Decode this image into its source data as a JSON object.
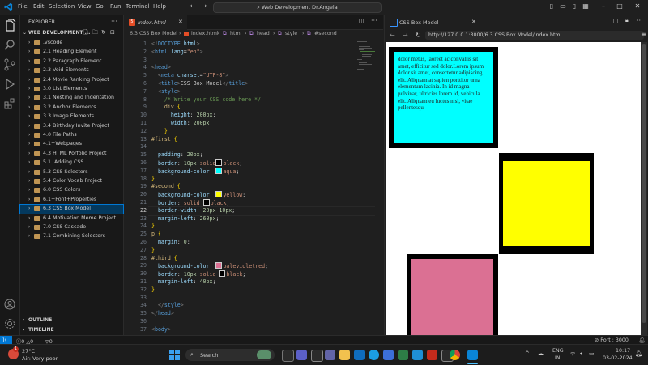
{
  "menu": [
    "File",
    "Edit",
    "Selection",
    "View",
    "Go",
    "Run",
    "Terminal",
    "Help"
  ],
  "search": {
    "text": "Web Development Dr.Angela"
  },
  "sidebar": {
    "title": "EXPLORER",
    "root": "WEB DEVELOPMENT ...",
    "items": [
      {
        "label": ".vscode"
      },
      {
        "label": "2.1 Heading Element"
      },
      {
        "label": "2.2 Paragraph Element"
      },
      {
        "label": "2.3 Void Elements"
      },
      {
        "label": "2.4 Movie Ranking Project"
      },
      {
        "label": "3.0 List Elements"
      },
      {
        "label": "3.1 Nesting and Indentation"
      },
      {
        "label": "3.2 Anchor Elements"
      },
      {
        "label": "3.3 Image Elements"
      },
      {
        "label": "3.4 Birthday Invite Project"
      },
      {
        "label": "4.0 File Paths"
      },
      {
        "label": "4.1+Webpages"
      },
      {
        "label": "4.3 HTML Porfolio Project"
      },
      {
        "label": "5.1. Adding CSS"
      },
      {
        "label": "5.3 CSS Selectors"
      },
      {
        "label": "5.4 Color Vocab Project"
      },
      {
        "label": "6.0 CSS Colors"
      },
      {
        "label": "6.1+Font+Properties"
      },
      {
        "label": "6.3 CSS Box Model"
      },
      {
        "label": "6.4 Motivation Meme Project"
      },
      {
        "label": "7.0 CSS Cascade"
      },
      {
        "label": "7.1 Combining Selectors"
      }
    ],
    "active_index": 18,
    "outline": "OUTLINE",
    "timeline": "TIMELINE"
  },
  "editor": {
    "tab": "index.html",
    "breadcrumb": {
      "folder": "6.3 CSS Box Model",
      "file": "index.html",
      "path": [
        "html",
        "head",
        "style",
        "#second"
      ]
    },
    "current_line": 22
  },
  "code_lines": [
    {
      "n": "1",
      "parts": [
        [
          "k-pun",
          "<!"
        ],
        [
          "k-tag",
          "DOCTYPE"
        ],
        [
          "k-attr",
          " html"
        ],
        [
          "k-pun",
          ">"
        ]
      ]
    },
    {
      "n": "2",
      "parts": [
        [
          "k-pun",
          "<"
        ],
        [
          "k-tag",
          "html"
        ],
        [
          "k-attr",
          " lang"
        ],
        [
          "",
          "="
        ],
        [
          "k-str",
          "\"en\""
        ],
        [
          "k-pun",
          ">"
        ]
      ]
    },
    {
      "n": "3",
      "parts": []
    },
    {
      "n": "4",
      "parts": [
        [
          "k-pun",
          "<"
        ],
        [
          "k-tag",
          "head"
        ],
        [
          "k-pun",
          ">"
        ]
      ]
    },
    {
      "n": "5",
      "parts": [
        [
          "",
          "  "
        ],
        [
          "k-pun",
          "<"
        ],
        [
          "k-tag",
          "meta"
        ],
        [
          "k-attr",
          " charset"
        ],
        [
          "",
          "="
        ],
        [
          "k-str",
          "\"UTF-8\""
        ],
        [
          "k-pun",
          ">"
        ]
      ]
    },
    {
      "n": "6",
      "parts": [
        [
          "",
          "  "
        ],
        [
          "k-pun",
          "<"
        ],
        [
          "k-tag",
          "title"
        ],
        [
          "k-pun",
          ">"
        ],
        [
          "",
          "CSS Box Model"
        ],
        [
          "k-pun",
          "</"
        ],
        [
          "k-tag",
          "title"
        ],
        [
          "k-pun",
          ">"
        ]
      ]
    },
    {
      "n": "7",
      "parts": [
        [
          "",
          "  "
        ],
        [
          "k-pun",
          "<"
        ],
        [
          "k-tag",
          "style"
        ],
        [
          "k-pun",
          ">"
        ]
      ]
    },
    {
      "n": "8",
      "parts": [
        [
          "",
          "    "
        ],
        [
          "k-cmt",
          "/* Write your CSS code here */"
        ]
      ]
    },
    {
      "n": "9",
      "parts": [
        [
          "",
          "    "
        ],
        [
          "k-sel",
          "div"
        ],
        [
          "k-brk",
          " {"
        ]
      ]
    },
    {
      "n": "10",
      "parts": [
        [
          "",
          "      "
        ],
        [
          "k-prop",
          "height"
        ],
        [
          "",
          ": "
        ],
        [
          "k-num",
          "200px"
        ],
        [
          "",
          ";"
        ]
      ]
    },
    {
      "n": "11",
      "parts": [
        [
          "",
          "      "
        ],
        [
          "k-prop",
          "width"
        ],
        [
          "",
          ": "
        ],
        [
          "k-num",
          "200px"
        ],
        [
          "",
          ";"
        ]
      ]
    },
    {
      "n": "12",
      "parts": [
        [
          "",
          "    "
        ],
        [
          "k-brk",
          "}"
        ]
      ]
    },
    {
      "n": "13",
      "parts": [
        [
          "k-sel",
          "#first"
        ],
        [
          "k-brk",
          " {"
        ]
      ]
    },
    {
      "n": "14",
      "parts": []
    },
    {
      "n": "15",
      "parts": [
        [
          "",
          "  "
        ],
        [
          "k-prop",
          "padding"
        ],
        [
          "",
          ": "
        ],
        [
          "k-num",
          "20px"
        ],
        [
          "",
          ";"
        ]
      ]
    },
    {
      "n": "16",
      "parts": [
        [
          "",
          "  "
        ],
        [
          "k-prop",
          "border"
        ],
        [
          "",
          ": "
        ],
        [
          "k-num",
          "10px"
        ],
        [
          "",
          " "
        ],
        [
          "k-val",
          "solid"
        ],
        [
          "sw:#000000",
          ""
        ],
        [
          "k-val",
          "black"
        ],
        [
          "",
          ";"
        ]
      ]
    },
    {
      "n": "17",
      "parts": [
        [
          "",
          "  "
        ],
        [
          "k-prop",
          "background-color"
        ],
        [
          "",
          ": "
        ],
        [
          "sw:#00ffff",
          ""
        ],
        [
          "k-val",
          "aqua"
        ],
        [
          "",
          ";"
        ]
      ]
    },
    {
      "n": "18",
      "parts": [
        [
          "k-brk",
          "}"
        ]
      ]
    },
    {
      "n": "19",
      "parts": [
        [
          "k-sel",
          "#second"
        ],
        [
          "k-brk",
          " {"
        ]
      ]
    },
    {
      "n": "20",
      "parts": [
        [
          "",
          "  "
        ],
        [
          "k-prop",
          "background-color"
        ],
        [
          "",
          ": "
        ],
        [
          "sw:#ffff00",
          ""
        ],
        [
          "k-val",
          "yellow"
        ],
        [
          "",
          ";"
        ]
      ]
    },
    {
      "n": "21",
      "parts": [
        [
          "",
          "  "
        ],
        [
          "k-prop",
          "border"
        ],
        [
          "",
          ": "
        ],
        [
          "k-val",
          "solid"
        ],
        [
          "",
          " "
        ],
        [
          "sw:#000000",
          ""
        ],
        [
          "k-val",
          "black"
        ],
        [
          "",
          ";"
        ]
      ]
    },
    {
      "n": "22",
      "parts": [
        [
          "",
          "  "
        ],
        [
          "k-prop",
          "border-width"
        ],
        [
          "",
          ": "
        ],
        [
          "k-num",
          "20px 10px"
        ],
        [
          "",
          ";"
        ]
      ]
    },
    {
      "n": "23",
      "parts": [
        [
          "",
          "  "
        ],
        [
          "k-prop",
          "margin-left"
        ],
        [
          "",
          ": "
        ],
        [
          "k-num",
          "260px"
        ],
        [
          "",
          ";"
        ]
      ]
    },
    {
      "n": "24",
      "parts": [
        [
          "k-brk",
          "}"
        ]
      ]
    },
    {
      "n": "25",
      "parts": [
        [
          "k-sel",
          "p"
        ],
        [
          "k-brk",
          " {"
        ]
      ]
    },
    {
      "n": "26",
      "parts": [
        [
          "",
          "  "
        ],
        [
          "k-prop",
          "margin"
        ],
        [
          "",
          ": "
        ],
        [
          "k-num",
          "0"
        ],
        [
          "",
          ";"
        ]
      ]
    },
    {
      "n": "27",
      "parts": [
        [
          "k-brk",
          "}"
        ]
      ]
    },
    {
      "n": "28",
      "parts": [
        [
          "k-sel",
          "#third"
        ],
        [
          "k-brk",
          " {"
        ]
      ]
    },
    {
      "n": "29",
      "parts": [
        [
          "",
          "  "
        ],
        [
          "k-prop",
          "background-color"
        ],
        [
          "",
          ": "
        ],
        [
          "sw:#db7093",
          ""
        ],
        [
          "k-val",
          "palevioletred"
        ],
        [
          "",
          ";"
        ]
      ]
    },
    {
      "n": "30",
      "parts": [
        [
          "",
          "  "
        ],
        [
          "k-prop",
          "border"
        ],
        [
          "",
          ": "
        ],
        [
          "k-num",
          "10px"
        ],
        [
          "",
          " "
        ],
        [
          "k-val",
          "solid"
        ],
        [
          "",
          " "
        ],
        [
          "sw:#000000",
          ""
        ],
        [
          "k-val",
          "black"
        ],
        [
          "",
          ";"
        ]
      ]
    },
    {
      "n": "31",
      "parts": [
        [
          "",
          "  "
        ],
        [
          "k-prop",
          "margin-left"
        ],
        [
          "",
          ": "
        ],
        [
          "k-num",
          "40px"
        ],
        [
          "",
          ";"
        ]
      ]
    },
    {
      "n": "32",
      "parts": [
        [
          "k-brk",
          "}"
        ]
      ]
    },
    {
      "n": "33",
      "parts": []
    },
    {
      "n": "34",
      "parts": [
        [
          "",
          "  "
        ],
        [
          "k-pun",
          "</"
        ],
        [
          "k-tag",
          "style"
        ],
        [
          "k-pun",
          ">"
        ]
      ]
    },
    {
      "n": "35",
      "parts": [
        [
          "k-pun",
          "</"
        ],
        [
          "k-tag",
          "head"
        ],
        [
          "k-pun",
          ">"
        ]
      ]
    },
    {
      "n": "36",
      "parts": []
    },
    {
      "n": "37",
      "parts": [
        [
          "k-pun",
          "<"
        ],
        [
          "k-tag",
          "body"
        ],
        [
          "k-pun",
          ">"
        ]
      ]
    }
  ],
  "browser": {
    "tab": "CSS Box Model",
    "url": "http://127.0.0.1:3000/6.3 CSS Box Model/index.html",
    "first_text": "dolor metus, laoreet ac convallis sit amet, efficitur sed dolor.Lorem ipsum dolor sit amet, consectetur adipiscing elit. Aliquam at sapien porttitor urna elementum lacinia. In id magna pulvinar, ultricies lorem id, vehicula elit. Aliquam eu luctus nisl, vitae pellentesqu"
  },
  "statusbar": {
    "errors": "0",
    "warnings": "0",
    "info": "0",
    "port": "Port : 3000"
  },
  "taskbar": {
    "weather_temp": "27°C",
    "weather_desc": "Air: Very poor",
    "search": "Search",
    "lang1": "ENG",
    "lang2": "IN",
    "time": "10:17",
    "date": "03-02-2024",
    "badge": "1"
  },
  "colors": {
    "accent": "#0078d4",
    "aqua": "#00ffff",
    "yellow": "#ffff00",
    "palevioletred": "#db7093"
  }
}
